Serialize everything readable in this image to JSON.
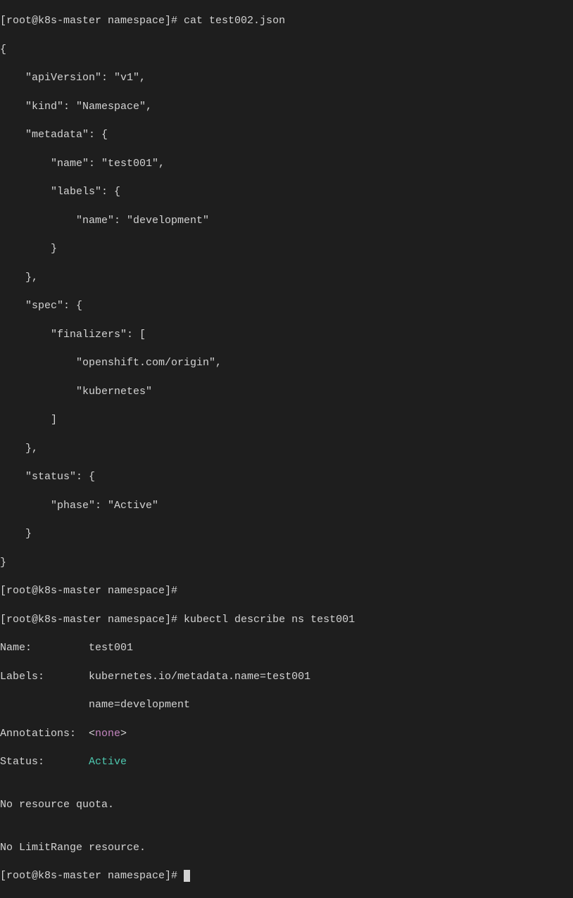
{
  "lines": {
    "l0": "[root@k8s-master namespace]# cat test002.json",
    "l1": "{",
    "l2": "    \"apiVersion\": \"v1\",",
    "l3": "    \"kind\": \"Namespace\",",
    "l4": "    \"metadata\": {",
    "l5": "        \"name\": \"test001\",",
    "l6": "        \"labels\": {",
    "l7": "            \"name\": \"development\"",
    "l8": "        }",
    "l9": "    },",
    "l10": "    \"spec\": {",
    "l11": "        \"finalizers\": [",
    "l12": "            \"openshift.com/origin\",",
    "l13": "            \"kubernetes\"",
    "l14": "        ]",
    "l15": "    },",
    "l16": "    \"status\": {",
    "l17": "        \"phase\": \"Active\"",
    "l18": "    }",
    "l19": "}",
    "l20": "[root@k8s-master namespace]# ",
    "l21": "[root@k8s-master namespace]# kubectl describe ns test001",
    "l22": "Name:         test001",
    "l23": "Labels:       kubernetes.io/metadata.name=test001",
    "l24": "              name=development",
    "l25a": "Annotations:  <",
    "l25b": "none",
    "l25c": ">",
    "l26a": "Status:       ",
    "l26b": "Active",
    "l27": "",
    "l28": "No resource quota.",
    "l29": "",
    "l30": "No LimitRange resource.",
    "l31": "[root@k8s-master namespace]# "
  }
}
